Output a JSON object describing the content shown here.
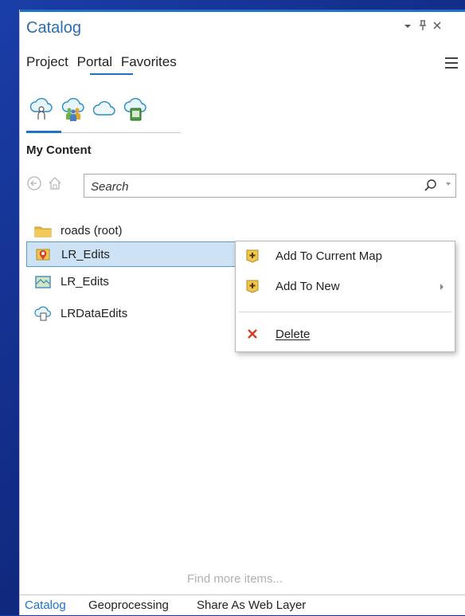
{
  "pane": {
    "title": "Catalog",
    "pin_glyph": "‑┤",
    "controls": {
      "dropdown": "▾",
      "pin": "Ѩ",
      "close": "✕"
    }
  },
  "tabs": [
    {
      "label": "Project",
      "active": false
    },
    {
      "label": "Portal",
      "active": true
    },
    {
      "label": "Favorites",
      "active": false
    }
  ],
  "portal_icons": [
    "my-content-cloud-icon",
    "groups-cloud-icon",
    "all-portal-cloud-icon",
    "living-atlas-cloud-icon"
  ],
  "section_title": "My Content",
  "search": {
    "placeholder": "Search"
  },
  "items": [
    {
      "label": "roads (root)",
      "icon": "folder-icon",
      "selected": false
    },
    {
      "label": "LR_Edits",
      "icon": "feature-service-icon",
      "selected": true
    },
    {
      "label": "LR_Edits",
      "icon": "map-service-icon",
      "selected": false
    },
    {
      "label": "LRDataEdits",
      "icon": "portal-item-icon",
      "selected": false
    }
  ],
  "context_menu": {
    "items": [
      {
        "label": "Add To Current Map",
        "icon": "add-data-icon"
      },
      {
        "label": "Add To New",
        "icon": "add-data-icon",
        "submenu": true
      },
      {
        "label": "Delete",
        "icon": "delete-icon"
      }
    ]
  },
  "find_more": "Find more items...",
  "bottom_tabs": [
    {
      "label": "Catalog",
      "active": true
    },
    {
      "label": "Geoprocessing",
      "active": false
    },
    {
      "label": "Share As Web Layer",
      "active": false
    }
  ],
  "colors": {
    "accent": "#1e73c8",
    "selection": "#cde3f5",
    "delete": "#d83b1f",
    "background": "#14308e"
  }
}
